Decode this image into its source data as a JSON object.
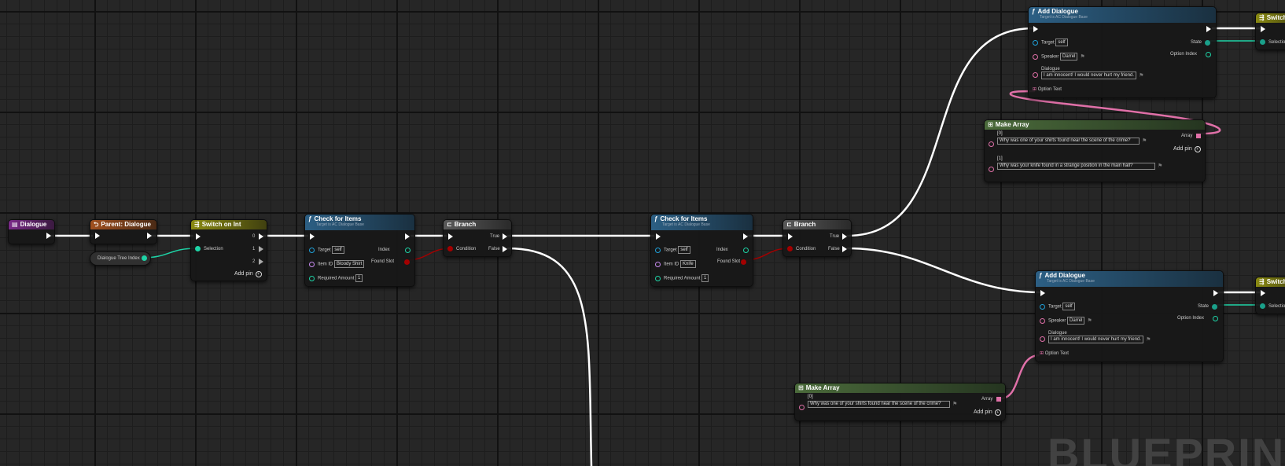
{
  "watermark": "BLUEPRINT",
  "nodes": {
    "dialogue_event": {
      "title": "Dialogue"
    },
    "parent_dialogue": {
      "title": "Parent: Dialogue"
    },
    "var_dialogue_tree_index": {
      "title": "Dialogue Tree Index"
    },
    "switch_on_int": {
      "title": "Switch on Int",
      "selection": "Selection",
      "outputs": [
        "0",
        "1",
        "2"
      ],
      "add_pin": "Add pin"
    },
    "check_items_1": {
      "title": "Check for Items",
      "subtitle": "Target is AC Dialogue Base",
      "target_label": "Target",
      "target_value": "self",
      "item_label": "Item ID",
      "item_value": "Bloody Shirt",
      "amount_label": "Required Amount",
      "amount_value": "1",
      "index_label": "Index",
      "found_label": "Found Slot"
    },
    "branch_1": {
      "title": "Branch",
      "condition": "Condition",
      "true_label": "True",
      "false_label": "False"
    },
    "check_items_2": {
      "title": "Check for Items",
      "subtitle": "Target is AC Dialogue Base",
      "target_label": "Target",
      "target_value": "self",
      "item_label": "Item ID",
      "item_value": "Knife",
      "amount_label": "Required Amount",
      "amount_value": "1",
      "index_label": "Index",
      "found_label": "Found Slot"
    },
    "branch_2": {
      "title": "Branch",
      "condition": "Condition",
      "true_label": "True",
      "false_label": "False"
    },
    "add_dialogue_1": {
      "title": "Add Dialogue",
      "subtitle": "Target is AC Dialogue Base",
      "target_label": "Target",
      "target_value": "self",
      "speaker_label": "Speaker",
      "speaker_value": "Darrel",
      "dialogue_label": "Dialogue",
      "dialogue_value": "I am innocent! I would never hurt my friend.",
      "option_text_label": "Option Text",
      "state_label": "State",
      "option_index_label": "Option Index"
    },
    "make_array_1": {
      "title": "Make Array",
      "array_label": "Array",
      "add_pin": "Add pin",
      "items": [
        {
          "index": "[0]",
          "text": "Why was one of your shirts found near the scene of the crime?"
        },
        {
          "index": "[1]",
          "text": "Why was your knife found in a strange position in the main hall?"
        }
      ]
    },
    "add_dialogue_2": {
      "title": "Add Dialogue",
      "subtitle": "Target is AC Dialogue Base",
      "target_label": "Target",
      "target_value": "self",
      "speaker_label": "Speaker",
      "speaker_value": "Darrel",
      "dialogue_label": "Dialogue",
      "dialogue_value": "I am innocent! I would never hurt my friend.",
      "option_text_label": "Option Text",
      "state_label": "State",
      "option_index_label": "Option Index"
    },
    "make_array_2": {
      "title": "Make Array",
      "array_label": "Array",
      "add_pin": "Add pin",
      "items": [
        {
          "index": "[0]",
          "text": "Why was one of your shirts found near the scene of the crime?"
        }
      ]
    },
    "switch_partial_1": {
      "title": "Switch",
      "selection": "Selection"
    },
    "switch_partial_2": {
      "title": "Switch",
      "selection": "Selection"
    }
  },
  "colors": {
    "event_header": "#7a2a88",
    "parent_header": "#a0501e",
    "switch_header": "#8a8a12",
    "function_header": "#2c5f84",
    "branch_header": "#5a5a5a",
    "make_array_header": "#4b6b3b",
    "exec_wire": "#ffffff",
    "int_pin": "#1ed3a6",
    "object_pin": "#1fa0d8",
    "name_pin": "#c78bf0",
    "bool_pin": "#a30000",
    "text_pin": "#e070a8"
  }
}
